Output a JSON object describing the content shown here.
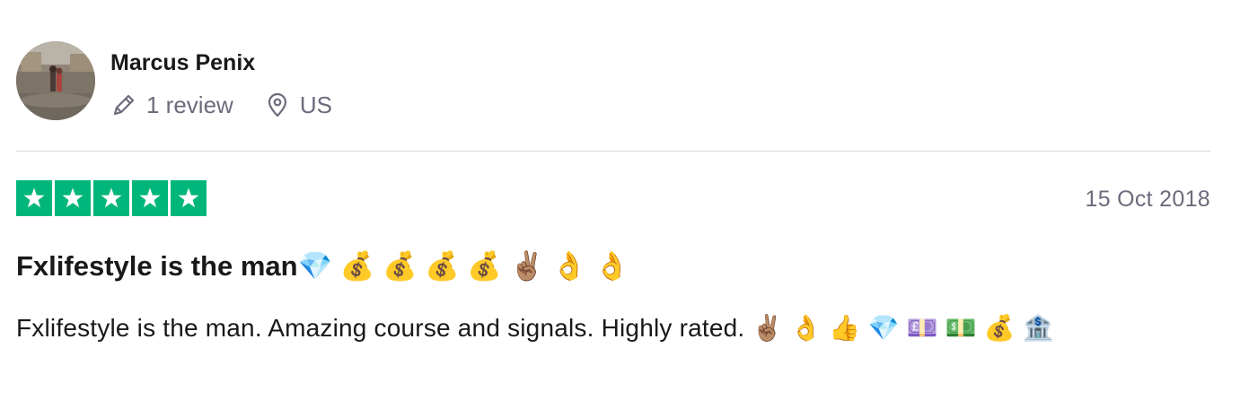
{
  "consumer": {
    "name": "Marcus Penix",
    "reviews": "1 review",
    "country": "US"
  },
  "review": {
    "rating": 5,
    "rating_max": 5,
    "date": "15 Oct 2018",
    "title": "Fxlifestyle is the man💎 💰 💰 💰 💰 ✌🏽 👌 👌",
    "body": "Fxlifestyle is the man. Amazing course and signals. Highly rated. ✌🏽 👌 👍 💎 💷 💵 💰 🏦"
  },
  "colors": {
    "star_green": "#00b67a",
    "meta_gray": "#6b6b7d",
    "divider": "#d6d6e0",
    "text": "#191919"
  },
  "icons": {
    "reviews": "pencil-icon",
    "location": "location-pin-icon",
    "star": "star-icon"
  }
}
